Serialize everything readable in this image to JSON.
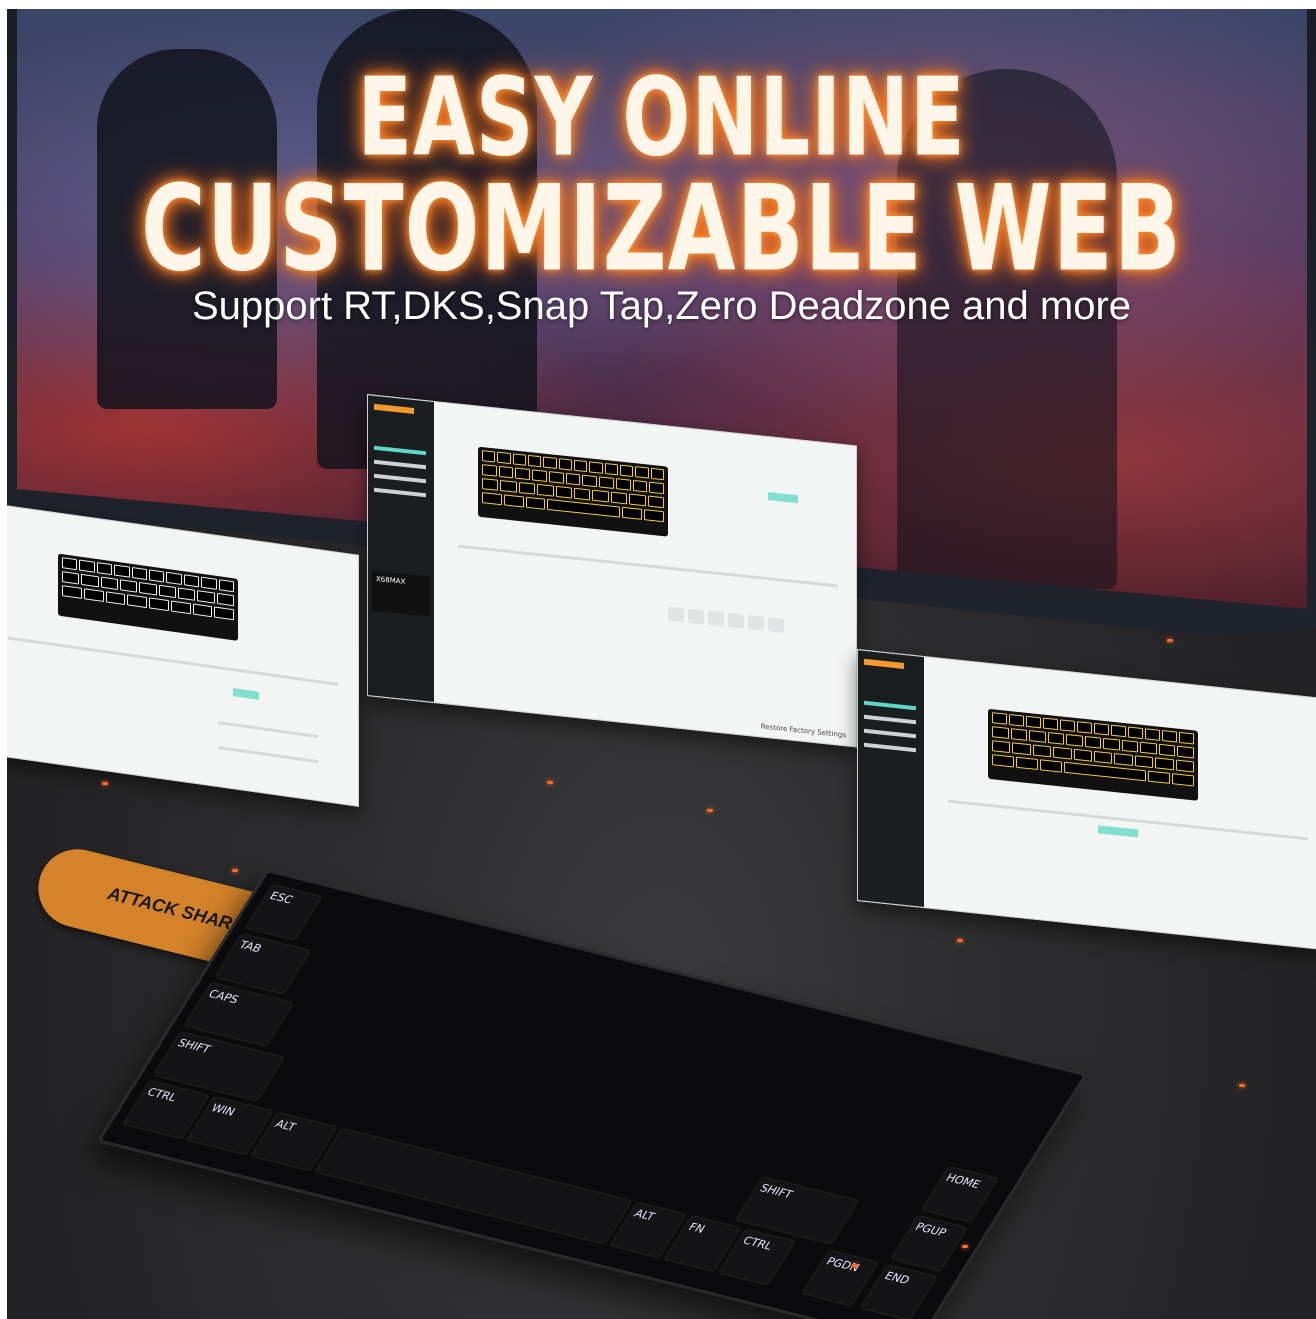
{
  "headline": {
    "line1": "EASY ONLINE",
    "line2": "CUSTOMIZABLE WEB",
    "subtitle": "Support RT,DKS,Snap Tap,Zero Deadzone and more"
  },
  "software_panel": {
    "device_name": "X68MAX",
    "footer_button": "Restore Factory Settings"
  },
  "keyboard": {
    "keys": [
      "ESC",
      "TAB",
      "CAPS",
      "SHIFT",
      "CTRL",
      "WIN",
      "ALT",
      "ALT",
      "FN",
      "CTRL",
      "SHIFT",
      "HOME",
      "PGUP",
      "PGDN",
      "END"
    ]
  },
  "strap": {
    "brand": "ATTACK SHARK"
  },
  "colors": {
    "headline_glow": "#ff7a1a",
    "accent_teal": "#5ed8c6",
    "strap_orange": "#d4832a"
  }
}
